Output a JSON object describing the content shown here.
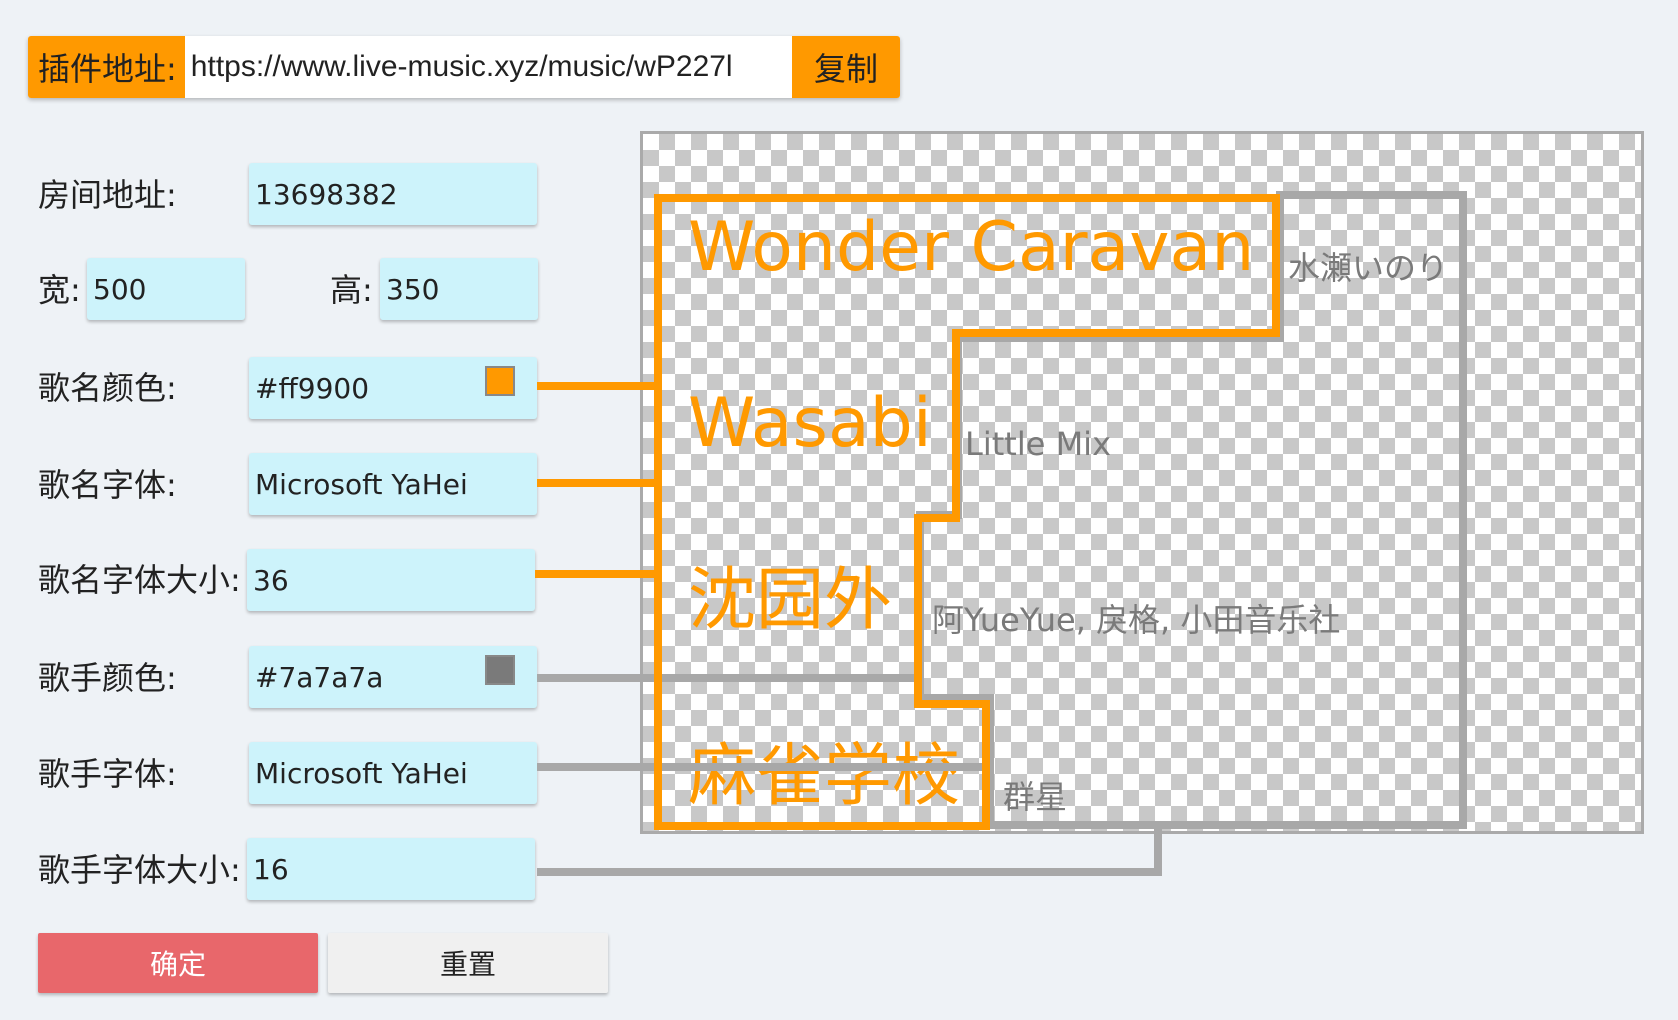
{
  "header": {
    "plugin_label": "插件地址:",
    "plugin_url": "https://www.live-music.xyz/music/wP227l",
    "copy_label": "复制"
  },
  "form": {
    "room": {
      "label": "房间地址:",
      "value": "13698382"
    },
    "width": {
      "label": "宽:",
      "value": "500"
    },
    "height": {
      "label": "高:",
      "value": "350"
    },
    "song_color": {
      "label": "歌名颜色:",
      "value": "#ff9900",
      "swatch": "#ff9900"
    },
    "song_font": {
      "label": "歌名字体:",
      "value": "Microsoft YaHei"
    },
    "song_size": {
      "label": "歌名字体大小:",
      "value": "36"
    },
    "artist_color": {
      "label": "歌手颜色:",
      "value": "#7a7a7a",
      "swatch": "#7a7a7a"
    },
    "artist_font": {
      "label": "歌手字体:",
      "value": "Microsoft YaHei"
    },
    "artist_size": {
      "label": "歌手字体大小:",
      "value": "16"
    }
  },
  "buttons": {
    "confirm": "确定",
    "reset": "重置"
  },
  "colors": {
    "accent": "#ff9900",
    "confirm_bg": "#e8676b",
    "reset_bg": "#f0f0f0",
    "field_bg": "#cdf3fb",
    "connector_gray": "#a8a8a8"
  },
  "preview": {
    "songs": [
      {
        "title": "Wonder Caravan",
        "artist": "水瀬いのり"
      },
      {
        "title": "Wasabi",
        "artist": "Little Mix"
      },
      {
        "title": "沈园外",
        "artist": "阿YueYue, 戾格, 小田音乐社"
      },
      {
        "title": "麻雀学校",
        "artist": "群星"
      }
    ]
  }
}
